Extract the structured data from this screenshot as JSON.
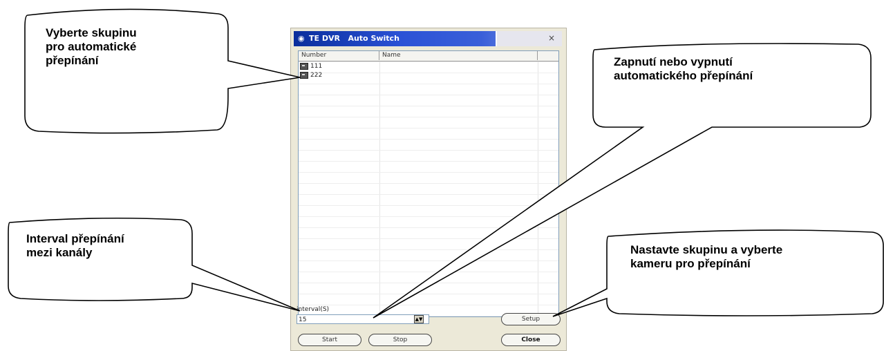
{
  "window": {
    "title": "TE DVR   Auto Switch",
    "close_glyph": "×",
    "app_icon": "camera-icon"
  },
  "list": {
    "columns": [
      "Number",
      "Name"
    ],
    "rows": [
      {
        "number": "111",
        "name": ""
      },
      {
        "number": "222",
        "name": ""
      }
    ]
  },
  "interval": {
    "label": "interval(S)",
    "value": "15"
  },
  "buttons": {
    "setup": "Setup",
    "start": "Start",
    "stop": "Stop",
    "close": "Close"
  },
  "callouts": {
    "select_group": [
      "Vyberte skupinu",
      "pro automatické",
      "přepínání"
    ],
    "toggle_switch": [
      "Zapnutí nebo vypnutí",
      "automatického přepínání"
    ],
    "interval": [
      "Interval přepínání",
      "mezi kanály"
    ],
    "setup_group": [
      "Nastavte skupinu a vyberte",
      "kameru pro přepínání"
    ]
  }
}
